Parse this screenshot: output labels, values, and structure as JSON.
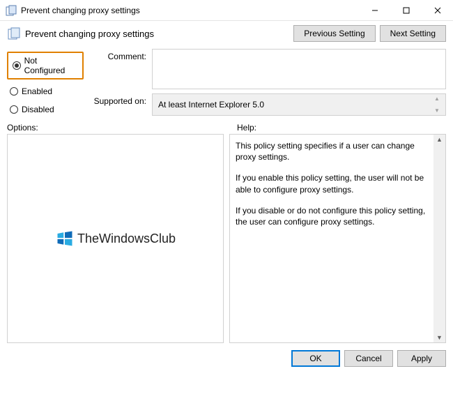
{
  "window": {
    "title": "Prevent changing proxy settings"
  },
  "header": {
    "title": "Prevent changing proxy settings",
    "previous": "Previous Setting",
    "next": "Next Setting"
  },
  "radios": {
    "not_configured": "Not Configured",
    "enabled": "Enabled",
    "disabled": "Disabled"
  },
  "form": {
    "comment_label": "Comment:",
    "comment_value": "",
    "supported_label": "Supported on:",
    "supported_value": "At least Internet Explorer 5.0"
  },
  "sections": {
    "options": "Options:",
    "help": "Help:"
  },
  "watermark": "TheWindowsClub",
  "help": {
    "p1": "This policy setting specifies if a user can change proxy settings.",
    "p2": "If you enable this policy setting, the user will not be able to configure proxy settings.",
    "p3": "If you disable or do not configure this policy setting, the user can configure proxy settings."
  },
  "footer": {
    "ok": "OK",
    "cancel": "Cancel",
    "apply": "Apply"
  }
}
